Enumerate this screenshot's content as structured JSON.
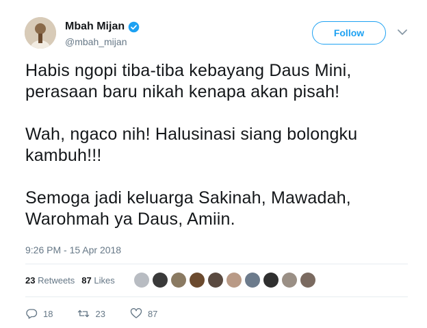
{
  "user": {
    "name": "Mbah Mijan",
    "handle": "@mbah_mijan"
  },
  "follow_label": "Follow",
  "tweet": {
    "paragraphs": [
      "Habis ngopi tiba-tiba kebayang Daus Mini, perasaan baru nikah kenapa akan pisah!",
      "Wah, ngaco nih! Halusinasi siang bolongku kambuh!!!",
      "Semoga jadi keluarga Sakinah, Mawadah, Warohmah ya Daus, Amiin."
    ],
    "timestamp": "9:26 PM - 15 Apr 2018"
  },
  "stats": {
    "retweets_count": "23",
    "retweets_label": "Retweets",
    "likes_count": "87",
    "likes_label": "Likes"
  },
  "liker_avatar_colors": [
    "#b8bcc2",
    "#3a3a3a",
    "#8a7a62",
    "#6b4a2e",
    "#5a4a40",
    "#b99a86",
    "#6c7b8c",
    "#2f2f2f",
    "#9a8f85",
    "#7a6a60"
  ],
  "actions": {
    "replies": "18",
    "retweets": "23",
    "likes": "87"
  },
  "colors": {
    "accent": "#1da1f2",
    "muted": "#657786",
    "text": "#14171a"
  }
}
